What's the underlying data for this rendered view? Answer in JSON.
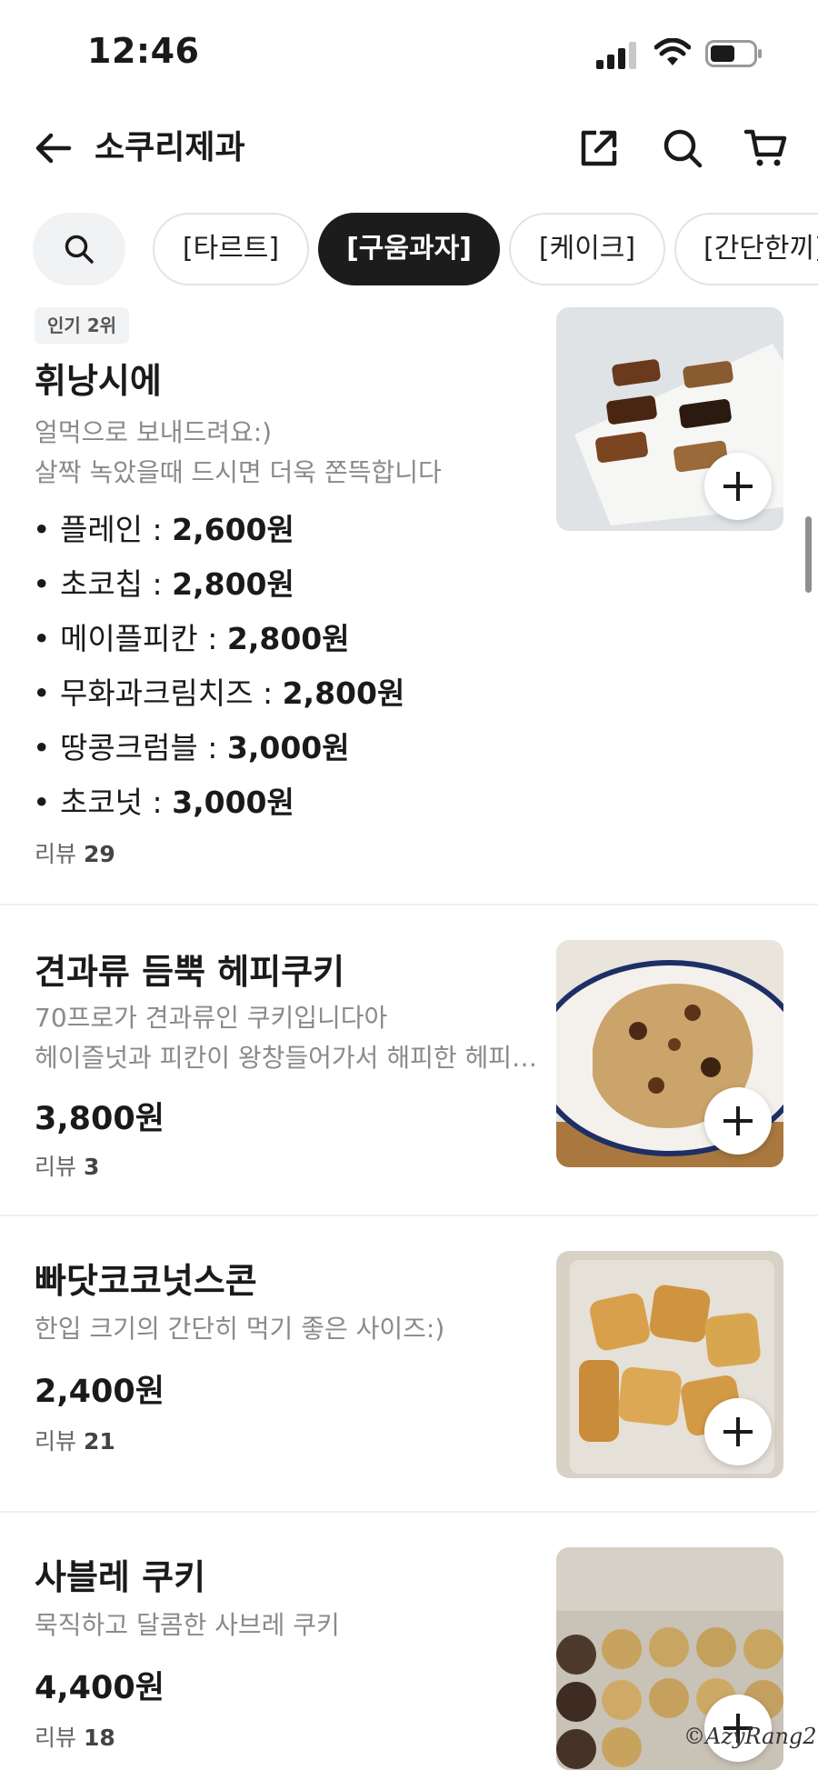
{
  "status_bar": {
    "time": "12:46"
  },
  "header": {
    "title": "소쿠리제과"
  },
  "categories": [
    {
      "label": "[타르트]"
    },
    {
      "label": "[구움과자]"
    },
    {
      "label": "[케이크]"
    },
    {
      "label": "[간단한끼]"
    }
  ],
  "active_category": "[구움과자]",
  "products": [
    {
      "badge": "인기 2위",
      "name": "휘낭시에",
      "desc_lines": [
        "얼먹으로 보내드려요:)",
        "살짝 녹았을때 드시면 더욱 쫀뜩합니다"
      ],
      "options": [
        {
          "name": "• 플레인 : ",
          "price": "2,600원"
        },
        {
          "name": "• 초코칩 : ",
          "price": "2,800원"
        },
        {
          "name": "• 메이플피칸 : ",
          "price": "2,800원"
        },
        {
          "name": "• 무화과크림치즈 : ",
          "price": "2,800원"
        },
        {
          "name": "• 땅콩크럼블 : ",
          "price": "3,000원"
        },
        {
          "name": "• 초코넛 : ",
          "price": "3,000원"
        }
      ],
      "review_label": "리뷰",
      "review_count": "29"
    },
    {
      "name": "견과류 듬뿍 헤피쿠키",
      "desc_lines": [
        "70프로가 견과류인 쿠키입니다아",
        "헤이즐넛과 피칸이 왕창들어가서 해피한 헤피쿠키"
      ],
      "price": "3,800원",
      "review_label": "리뷰",
      "review_count": "3"
    },
    {
      "name": "빠닷코코넛스콘",
      "desc_lines": [
        "한입 크기의 간단히 먹기 좋은 사이즈:)"
      ],
      "price": "2,400원",
      "review_label": "리뷰",
      "review_count": "21"
    },
    {
      "name": "사블레 쿠키",
      "desc_lines": [
        "묵직하고 달콤한 사브레 쿠키"
      ],
      "price": "4,400원",
      "review_label": "리뷰",
      "review_count": "18"
    }
  ],
  "watermark": "©AzyRang2",
  "colors": {
    "active_chip": "#1c1c1c",
    "muted_text": "#8a8a8a",
    "divider": "#f0f0f0"
  }
}
